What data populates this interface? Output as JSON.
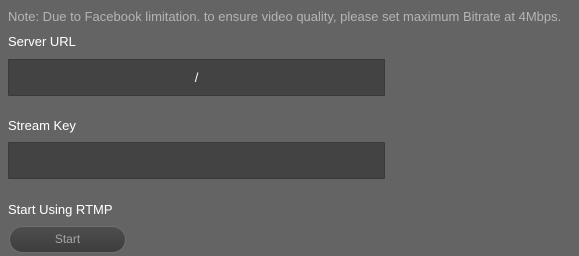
{
  "note": "Note: Due to Facebook limitation. to ensure video quality, please set maximum Bitrate at 4Mbps.",
  "server_url": {
    "label": "Server URL",
    "value": "/"
  },
  "stream_key": {
    "label": "Stream Key",
    "value": ""
  },
  "rtmp": {
    "label": "Start Using RTMP",
    "start_label": "Start"
  }
}
